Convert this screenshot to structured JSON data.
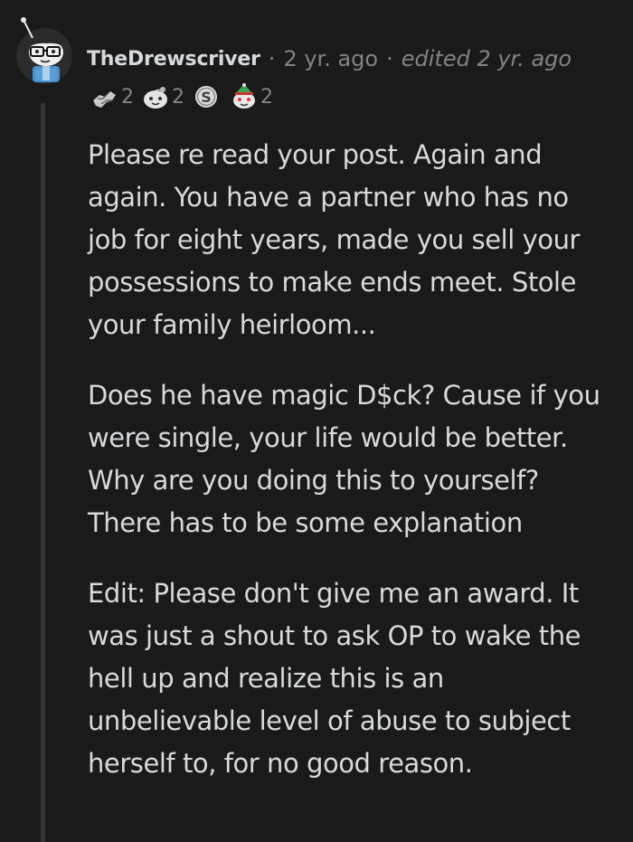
{
  "comment": {
    "username": "TheDrewscriver",
    "separator": "·",
    "timestamp": "2 yr. ago",
    "edited": "edited 2 yr. ago",
    "awards": [
      {
        "icon": "helping-hand-award-icon",
        "count": "2"
      },
      {
        "icon": "wholesome-award-icon",
        "count": "2"
      },
      {
        "icon": "silver-award-icon",
        "count": ""
      },
      {
        "icon": "snoo-elf-award-icon",
        "count": "2"
      }
    ],
    "paragraphs": [
      "Please re read your post. Again and again. You have a partner who has no job for eight years, made you sell your possessions to make ends meet. Stole your family heirloom...",
      "Does he have magic D$ck? Cause if you were single, your life would be better. Why are you doing this to yourself? There has to be some explanation",
      "Edit: Please don't give me an award. It was just a shout to ask OP to wake the hell up and realize this is an unbelievable level of abuse to subject herself to, for no good reason."
    ]
  },
  "colors": {
    "background": "#1a1a1b",
    "text": "#d7dadc",
    "meta": "#818384",
    "thread_line": "#343536"
  }
}
